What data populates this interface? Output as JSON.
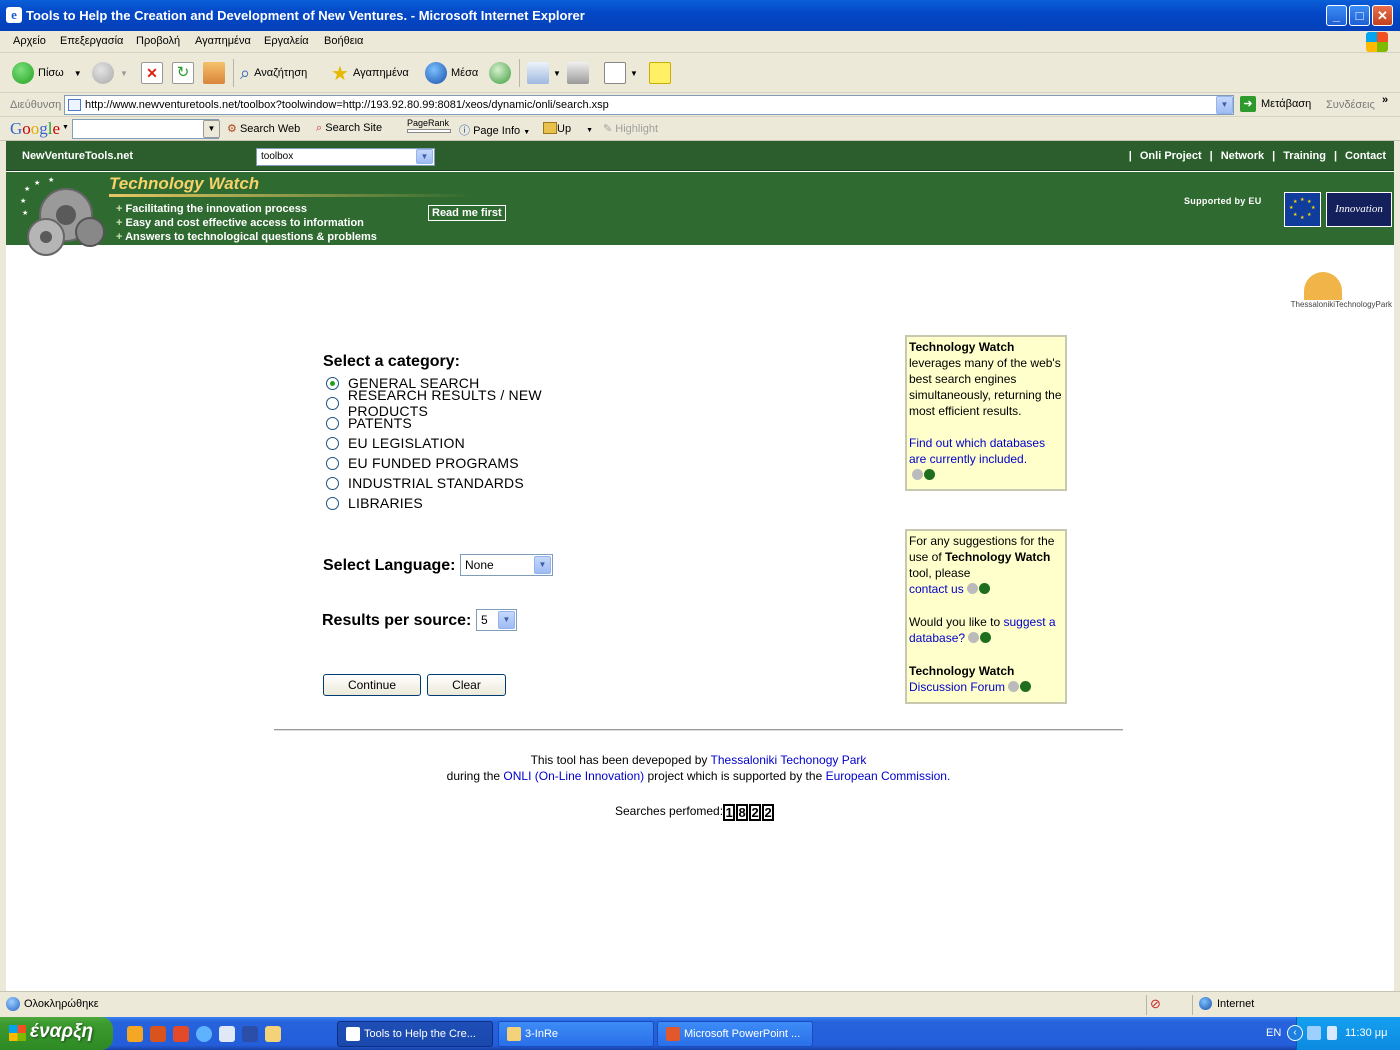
{
  "window": {
    "title": "Tools to Help the Creation and Development of New Ventures. - Microsoft Internet Explorer"
  },
  "menu": [
    "Αρχείο",
    "Επεξεργασία",
    "Προβολή",
    "Αγαπημένα",
    "Εργαλεία",
    "Βοήθεια"
  ],
  "toolbar": {
    "back": "Πίσω",
    "search": "Αναζήτηση",
    "favorites": "Αγαπημένα",
    "media": "Μέσα"
  },
  "address": {
    "label": "Διεύθυνση",
    "url": "http://www.newventuretools.net/toolbox?toolwindow=http://193.92.80.99:8081/xeos/dynamic/onli/search.xsp",
    "go": "Μετάβαση",
    "links": "Συνδέσεις"
  },
  "google": {
    "logo": "Google",
    "search_web": "Search Web",
    "search_site": "Search Site",
    "pagerank": "PageRank",
    "page_info": "Page Info",
    "up": "Up",
    "highlight": "Highlight"
  },
  "site": {
    "brand": "NewVentureTools.net",
    "toolbox_select": "toolbox",
    "nav": [
      "Onli Project",
      "Network",
      "Training",
      "Contact"
    ],
    "banner": {
      "title": "Technology Watch",
      "bullets": [
        "Facilitating the innovation process",
        "Easy and cost effective access to information",
        "Answers to technological questions & problems"
      ],
      "read_me": "Read me first",
      "supported": "Supported by EU",
      "innovation_logo": "Innovation"
    },
    "park_logo": "ThessalonikiTechnologyPark"
  },
  "form": {
    "category_heading": "Select a category:",
    "categories": [
      {
        "label": "GENERAL SEARCH",
        "selected": true
      },
      {
        "label": "RESEARCH RESULTS / NEW PRODUCTS",
        "selected": false
      },
      {
        "label": "PATENTS",
        "selected": false
      },
      {
        "label": "EU LEGISLATION",
        "selected": false
      },
      {
        "label": "EU FUNDED PROGRAMS",
        "selected": false
      },
      {
        "label": "INDUSTRIAL STANDARDS",
        "selected": false
      },
      {
        "label": "LIBRARIES",
        "selected": false
      }
    ],
    "language_label": "Select Language:",
    "language_value": "None",
    "results_label": "Results per source:",
    "results_value": "5",
    "continue": "Continue",
    "clear": "Clear"
  },
  "sidebox1": {
    "title": "Technology Watch",
    "text": "leverages many of the web's best search engines simultaneously, returning the most efficient results.",
    "link": "Find out which databases are currently included."
  },
  "sidebox2": {
    "text1": "For any suggestions for the use of ",
    "bold1": "Technology Watch",
    "text2": " tool, please",
    "contact_link": "contact us",
    "text3": "Would you like to ",
    "suggest_link": "suggest a database?",
    "forum_title": "Technology Watch",
    "forum_link": "Discussion Forum"
  },
  "footer": {
    "line1_text": "This tool has been devepoped by ",
    "line1_link": "Thessaloniki Techonogy Park",
    "line2_text1": "during the ",
    "line2_link1": "ONLI (On-Line Innovation)",
    "line2_text2": " project which is supported by the ",
    "line2_link2": "European Commission.",
    "counter_label": "Searches perfomed:",
    "counter_digits": [
      "1",
      "8",
      "2",
      "2"
    ]
  },
  "status": {
    "text": "Ολοκληρώθηκε",
    "zone": "Internet"
  },
  "taskbar": {
    "start": "έναρξη",
    "tasks": [
      "Tools to Help the Cre...",
      "3-InRe",
      "Microsoft PowerPoint ..."
    ],
    "lang": "EN",
    "clock": "11:30 μμ"
  }
}
